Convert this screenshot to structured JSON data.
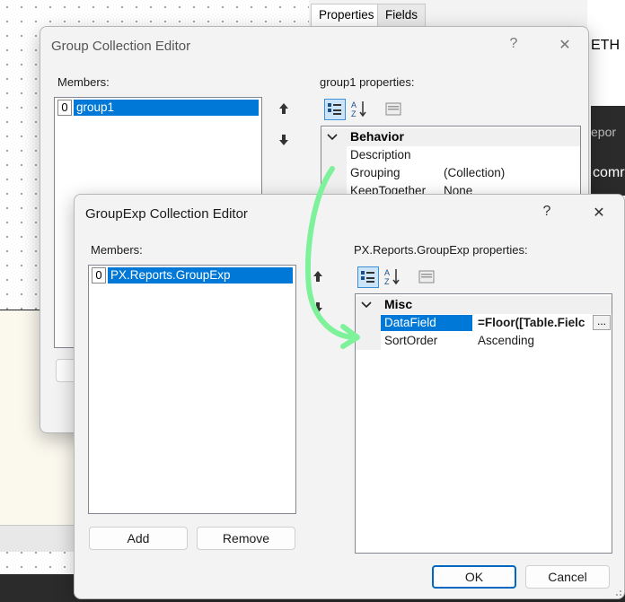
{
  "background": {
    "tabs": [
      "Properties",
      "Fields"
    ],
    "right_text_top": "ETH",
    "right_text_mid": "epor",
    "right_text_low": "comr"
  },
  "group_dialog": {
    "title": "Group Collection Editor",
    "help": "?",
    "close": "✕",
    "members_label": "Members:",
    "members": [
      {
        "index": "0",
        "name": "group1"
      }
    ],
    "props_label": "group1 properties:",
    "properties": [
      {
        "category": "Behavior"
      },
      {
        "name": "Description",
        "value": ""
      },
      {
        "name": "Grouping",
        "value": "(Collection)"
      },
      {
        "name": "KeepTogether",
        "value": "None"
      }
    ]
  },
  "groupexp_dialog": {
    "title": "GroupExp Collection Editor",
    "help": "?",
    "close": "✕",
    "members_label": "Members:",
    "members": [
      {
        "index": "0",
        "name": "PX.Reports.GroupExp"
      }
    ],
    "props_label": "PX.Reports.GroupExp properties:",
    "category": "Misc",
    "properties": [
      {
        "name": "DataField",
        "value": "=Floor([Table.Fielc",
        "ellipsis": "..."
      },
      {
        "name": "SortOrder",
        "value": "Ascending"
      }
    ],
    "add_label": "Add",
    "remove_label": "Remove",
    "ok_label": "OK",
    "cancel_label": "Cancel"
  },
  "colors": {
    "selection": "#0078d7",
    "annotation_arrow": "#7ef29a",
    "primary_border": "#0067c0"
  }
}
